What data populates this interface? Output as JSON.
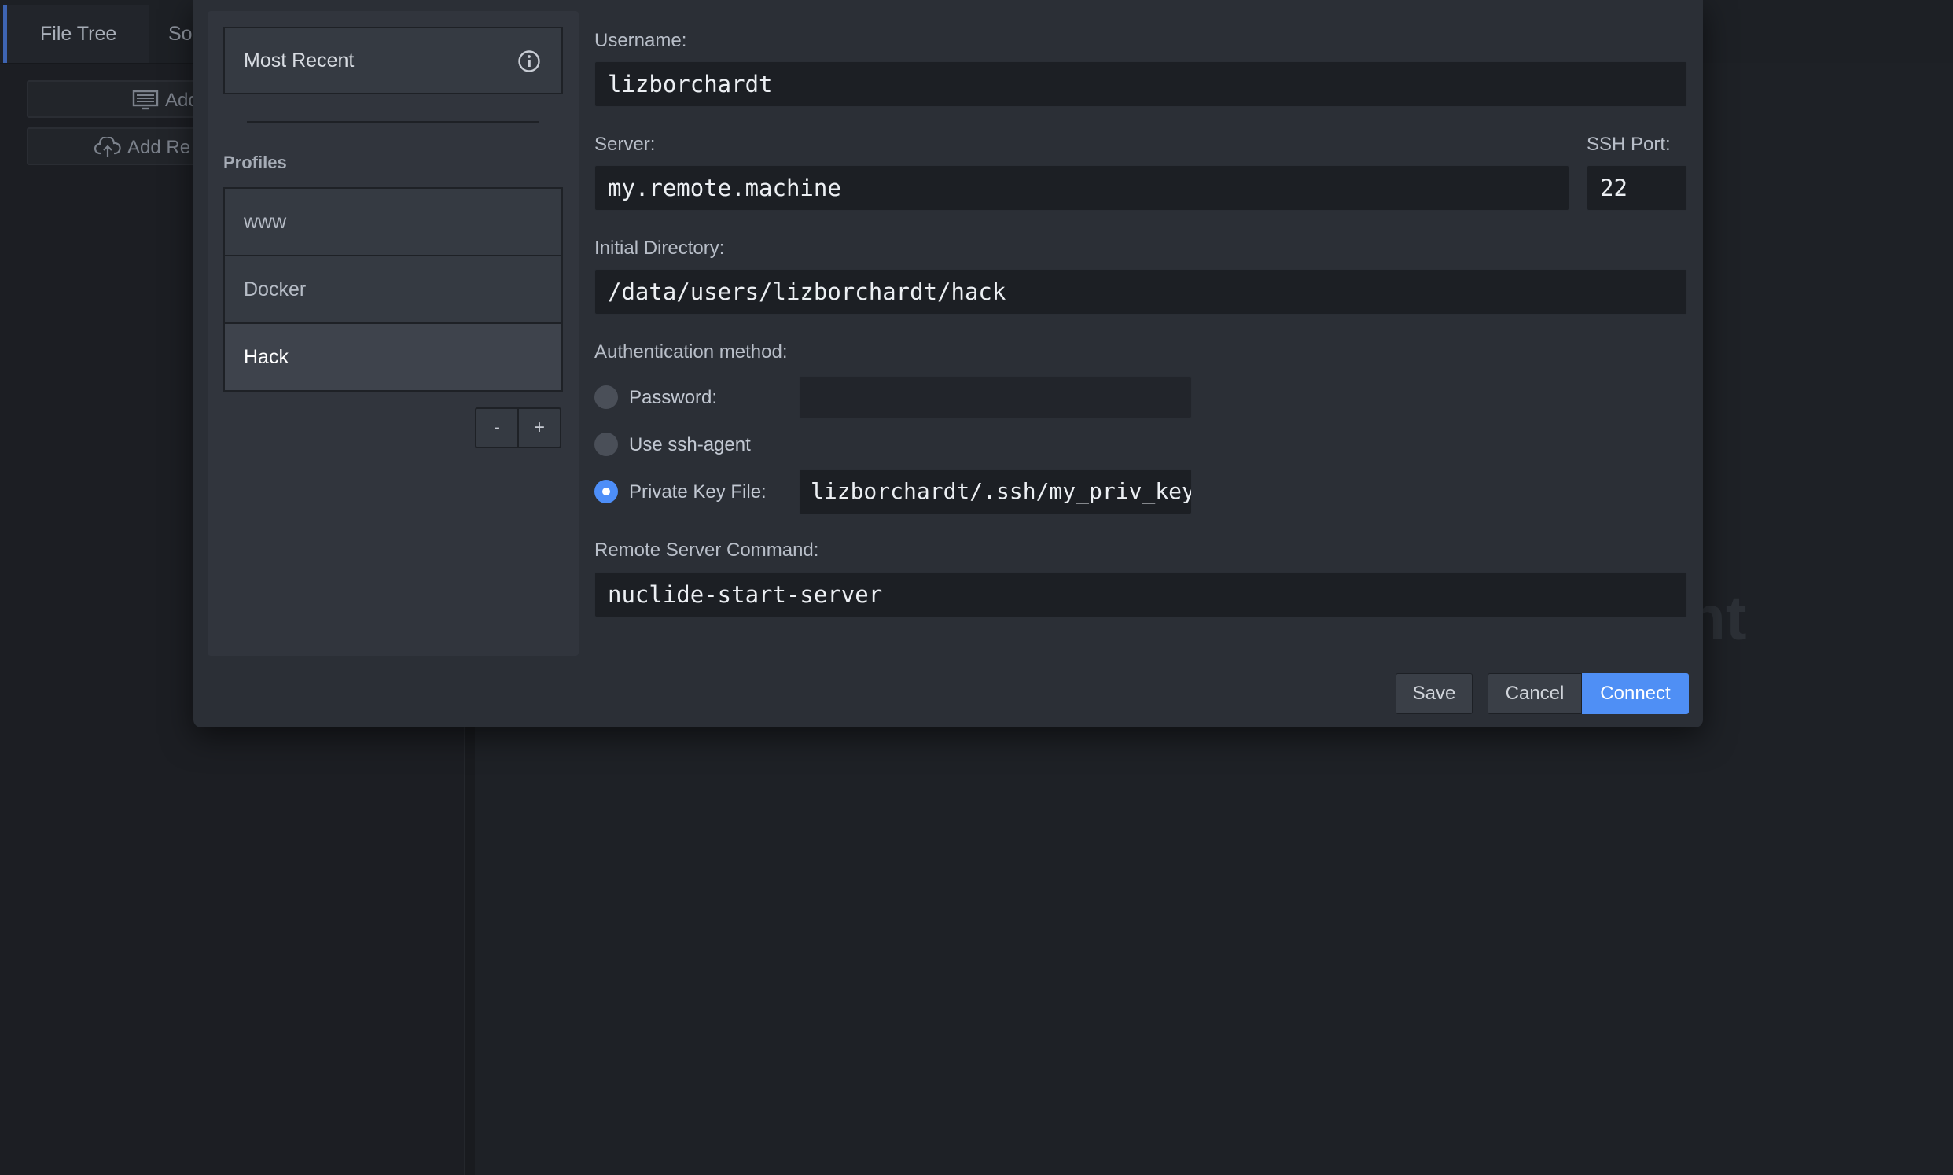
{
  "background": {
    "tabs": [
      {
        "label": "File Tree"
      },
      {
        "label": "So"
      }
    ],
    "sidebar_buttons": [
      {
        "label": "Add",
        "icon": "monitor-icon"
      },
      {
        "label": "Add Re",
        "icon": "cloud-upload-icon"
      }
    ],
    "ghost_text": "nt"
  },
  "profiles": {
    "most_recent_label": "Most Recent",
    "heading": "Profiles",
    "items": [
      {
        "label": "www",
        "selected": false
      },
      {
        "label": "Docker",
        "selected": false
      },
      {
        "label": "Hack",
        "selected": true
      }
    ],
    "remove_label": "-",
    "add_label": "+"
  },
  "form": {
    "username_label": "Username:",
    "username_value": "lizborchardt",
    "server_label": "Server:",
    "server_value": "my.remote.machine",
    "ssh_port_label": "SSH Port:",
    "ssh_port_value": "22",
    "initial_dir_label": "Initial Directory:",
    "initial_dir_value": "/data/users/lizborchardt/hack",
    "auth_label": "Authentication method:",
    "auth_options": [
      {
        "label": "Password:",
        "checked": false
      },
      {
        "label": "Use ssh-agent",
        "checked": false
      },
      {
        "label": "Private Key File:",
        "checked": true
      }
    ],
    "password_value": "",
    "private_key_value": "lizborchardt/.ssh/my_priv_key",
    "remote_cmd_label": "Remote Server Command:",
    "remote_cmd_value": "nuclide-start-server"
  },
  "actions": {
    "save_label": "Save",
    "cancel_label": "Cancel",
    "connect_label": "Connect"
  },
  "colors": {
    "accent": "#4f8ff5",
    "modal_bg": "#2b2f36",
    "field_bg": "#1c1f24"
  }
}
